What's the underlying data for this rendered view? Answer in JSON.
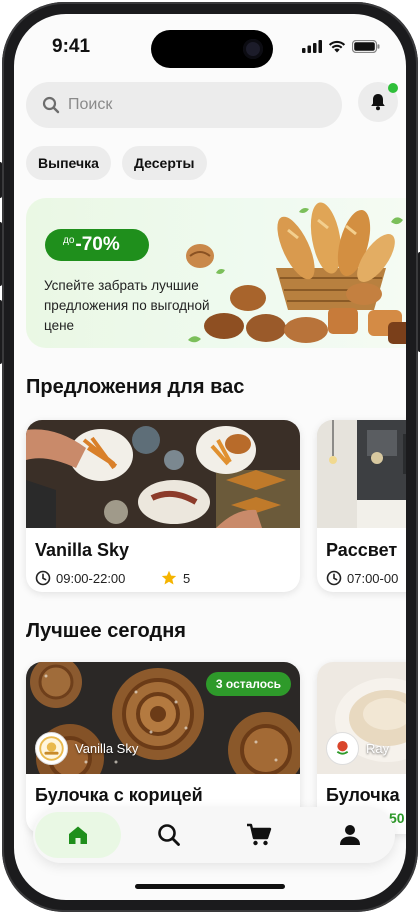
{
  "status_bar": {
    "time": "9:41"
  },
  "search": {
    "placeholder": "Поиск"
  },
  "categories": [
    {
      "label": "Выпечка"
    },
    {
      "label": "Десерты"
    }
  ],
  "promo": {
    "badge_prefix": "до",
    "badge_value": "-70%",
    "text": "Успейте забрать лучшие предложения по выгодной цене"
  },
  "sections": {
    "offers_title": "Предложения для вас",
    "best_title": "Лучшее сегодня"
  },
  "offers": [
    {
      "name": "Vanilla Sky",
      "hours": "09:00-22:00",
      "rating": "5"
    },
    {
      "name": "Рассвет",
      "hours": "07:00-00"
    }
  ],
  "best": [
    {
      "badge": "3 осталось",
      "shop": "Vanilla Sky",
      "name": "Булочка с корицей"
    },
    {
      "shop": "Ray",
      "name": "Булочка",
      "price_partial": "50"
    }
  ],
  "tabbar": {
    "items": [
      "home",
      "search",
      "cart",
      "profile"
    ],
    "active": "home"
  },
  "colors": {
    "accent": "#1f8f1c",
    "active_tab_bg": "#e9f8e4",
    "notification_dot": "#2fbf3a"
  },
  "icons": [
    "search-icon",
    "bell-icon",
    "clock-icon",
    "star-icon",
    "home-icon",
    "cart-icon",
    "profile-icon"
  ]
}
